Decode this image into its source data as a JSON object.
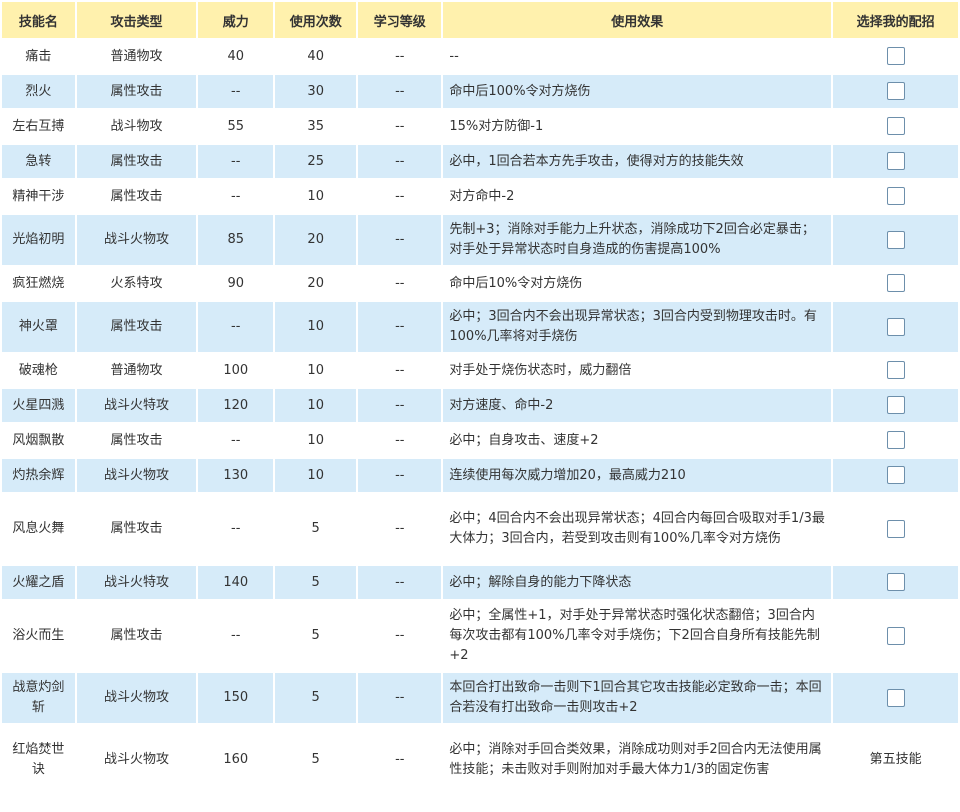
{
  "headers": [
    "技能名",
    "攻击类型",
    "威力",
    "使用次数",
    "学习等级",
    "使用效果",
    "选择我的配招"
  ],
  "rows": [
    {
      "name": "痛击",
      "type": "普通物攻",
      "power": "40",
      "uses": "40",
      "level": "--",
      "effect": "--",
      "select": "checkbox"
    },
    {
      "name": "烈火",
      "type": "属性攻击",
      "power": "--",
      "uses": "30",
      "level": "--",
      "effect": "命中后100%令对方烧伤",
      "select": "checkbox"
    },
    {
      "name": "左右互搏",
      "type": "战斗物攻",
      "power": "55",
      "uses": "35",
      "level": "--",
      "effect": "15%对方防御-1",
      "select": "checkbox"
    },
    {
      "name": "急转",
      "type": "属性攻击",
      "power": "--",
      "uses": "25",
      "level": "--",
      "effect": "必中，1回合若本方先手攻击，使得对方的技能失效",
      "select": "checkbox"
    },
    {
      "name": "精神干涉",
      "type": "属性攻击",
      "power": "--",
      "uses": "10",
      "level": "--",
      "effect": "对方命中-2",
      "select": "checkbox"
    },
    {
      "name": "光焰初明",
      "type": "战斗火物攻",
      "power": "85",
      "uses": "20",
      "level": "--",
      "effect": "先制+3；消除对手能力上升状态，消除成功下2回合必定暴击；对手处于异常状态时自身造成的伤害提高100%",
      "select": "checkbox"
    },
    {
      "name": "疯狂燃烧",
      "type": "火系特攻",
      "power": "90",
      "uses": "20",
      "level": "--",
      "effect": "命中后10%令对方烧伤",
      "select": "checkbox"
    },
    {
      "name": "神火罩",
      "type": "属性攻击",
      "power": "--",
      "uses": "10",
      "level": "--",
      "effect": "必中；3回合内不会出现异常状态；3回合内受到物理攻击时。有100%几率将对手烧伤",
      "select": "checkbox"
    },
    {
      "name": "破魂枪",
      "type": "普通物攻",
      "power": "100",
      "uses": "10",
      "level": "--",
      "effect": "对手处于烧伤状态时，威力翻倍",
      "select": "checkbox"
    },
    {
      "name": "火星四溅",
      "type": "战斗火特攻",
      "power": "120",
      "uses": "10",
      "level": "--",
      "effect": "对方速度、命中-2",
      "select": "checkbox"
    },
    {
      "name": "风烟飘散",
      "type": "属性攻击",
      "power": "--",
      "uses": "10",
      "level": "--",
      "effect": "必中；自身攻击、速度+2",
      "select": "checkbox"
    },
    {
      "name": "灼热余辉",
      "type": "战斗火物攻",
      "power": "130",
      "uses": "10",
      "level": "--",
      "effect": "连续使用每次威力增加20，最高威力210",
      "select": "checkbox"
    },
    {
      "name": "风息火舞",
      "type": "属性攻击",
      "power": "--",
      "uses": "5",
      "level": "--",
      "effect": "必中；4回合内不会出现异常状态；4回合内每回合吸取对手1/3最大体力；3回合内，若受到攻击则有100%几率令对方烧伤",
      "select": "checkbox"
    },
    {
      "name": "火耀之盾",
      "type": "战斗火特攻",
      "power": "140",
      "uses": "5",
      "level": "--",
      "effect": "必中；解除自身的能力下降状态",
      "select": "checkbox"
    },
    {
      "name": "浴火而生",
      "type": "属性攻击",
      "power": "--",
      "uses": "5",
      "level": "--",
      "effect": "必中；全属性+1，对手处于异常状态时强化状态翻倍；3回合内每次攻击都有100%几率令对手烧伤；下2回合自身所有技能先制+2",
      "select": "checkbox"
    },
    {
      "name": "战意灼剑斩",
      "type": "战斗火物攻",
      "power": "150",
      "uses": "5",
      "level": "--",
      "effect": "本回合打出致命一击则下1回合其它攻击技能必定致命一击；本回合若没有打出致命一击则攻击+2",
      "select": "checkbox"
    },
    {
      "name": "红焰焚世诀",
      "type": "战斗火物攻",
      "power": "160",
      "uses": "5",
      "level": "--",
      "effect": "必中；消除对手回合类效果，消除成功则对手2回合内无法使用属性技能；未击败对手则附加对手最大体力1/3的固定伤害",
      "select": "第五技能"
    }
  ]
}
